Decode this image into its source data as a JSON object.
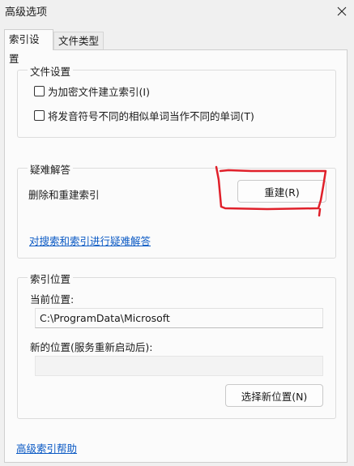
{
  "window": {
    "title": "高级选项",
    "close_icon": "close-icon"
  },
  "tabs": [
    {
      "label": "索引设置",
      "active": true
    },
    {
      "label": "文件类型",
      "active": false
    }
  ],
  "file_settings": {
    "title": "文件设置",
    "options": [
      {
        "label": "为加密文件建立索引(I)",
        "checked": false
      },
      {
        "label": "将发音符号不同的相似单词当作不同的单词(T)",
        "checked": false
      }
    ]
  },
  "troubleshoot": {
    "title": "疑难解答",
    "rebuild_text": "删除和重建索引",
    "rebuild_button": "重建(R)",
    "link": "对搜索和索引进行疑难解答"
  },
  "index_location": {
    "title": "索引位置",
    "current_label": "当前位置:",
    "current_value": "C:\\ProgramData\\Microsoft",
    "new_label": "新的位置(服务重新启动后):",
    "new_value": "",
    "select_button": "选择新位置(N)"
  },
  "help_link": "高级索引帮助",
  "colors": {
    "annotation": "#e0202a",
    "link": "#0a59c4"
  }
}
